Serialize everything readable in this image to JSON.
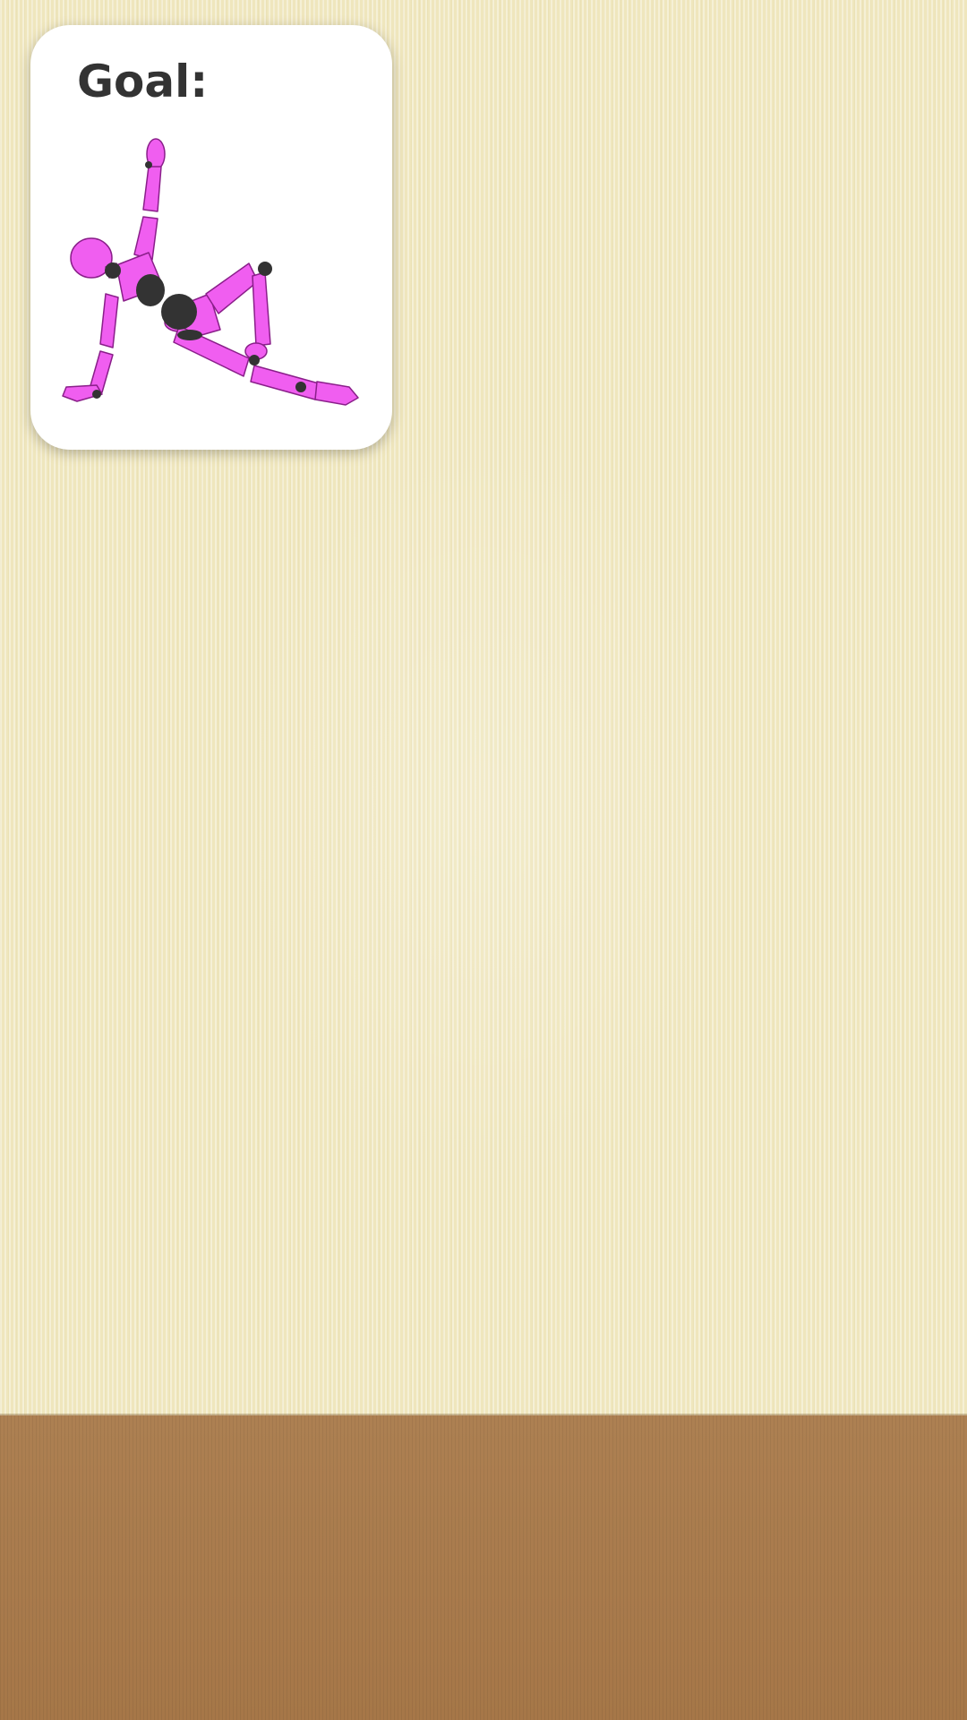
{
  "goal_card": {
    "title": "Goal:",
    "figure_icon": "mannequin-pose-icon",
    "figure_color": "#f05ef0",
    "joint_color": "#333333"
  },
  "scene": {
    "wall_color": "#efe6bd",
    "floor_color": "#a87a4c"
  }
}
